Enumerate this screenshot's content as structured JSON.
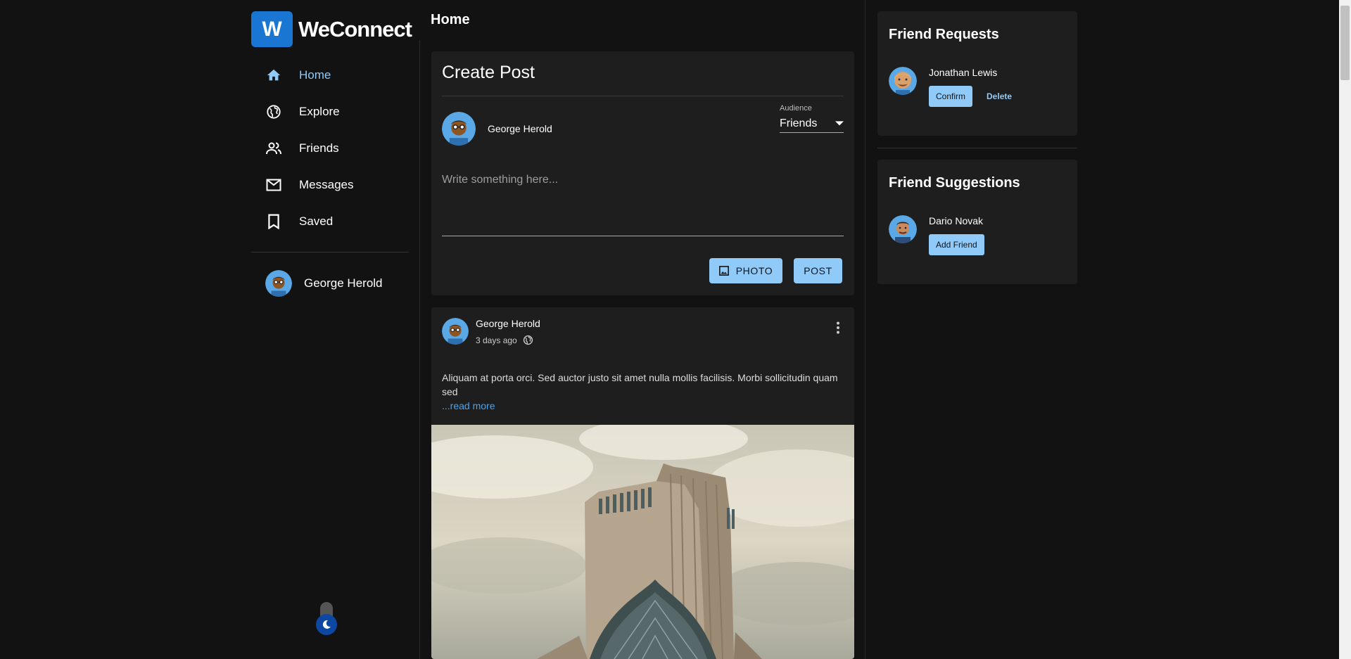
{
  "app": {
    "logo_letter": "W",
    "name": "WeConnect",
    "brand_color": "#1976d2",
    "accent_color": "#90caf9"
  },
  "nav": {
    "items": [
      {
        "label": "Home",
        "icon": "home-icon",
        "active": true
      },
      {
        "label": "Explore",
        "icon": "globe-icon",
        "active": false
      },
      {
        "label": "Friends",
        "icon": "people-icon",
        "active": false
      },
      {
        "label": "Messages",
        "icon": "mail-icon",
        "active": false
      },
      {
        "label": "Saved",
        "icon": "bookmark-icon",
        "active": false
      }
    ]
  },
  "current_user": {
    "name": "George Herold"
  },
  "theme_toggle": {
    "icon": "moon-icon",
    "mode": "dark"
  },
  "header": {
    "title": "Home"
  },
  "create_post": {
    "title": "Create Post",
    "author": "George Herold",
    "audience_label": "Audience",
    "audience_value": "Friends",
    "placeholder": "Write something here...",
    "photo_label": "PHOTO",
    "post_label": "POST"
  },
  "post": {
    "author": "George Herold",
    "time": "3 days ago",
    "visibility_icon": "globe-icon",
    "text": "Aliquam at porta orci. Sed auctor justo sit amet nulla mollis facilisis. Morbi sollicitudin quam sed",
    "read_more": "...read more"
  },
  "friend_requests": {
    "title": "Friend Requests",
    "items": [
      {
        "name": "Jonathan Lewis",
        "confirm_label": "Confirm",
        "delete_label": "Delete"
      }
    ]
  },
  "friend_suggestions": {
    "title": "Friend Suggestions",
    "items": [
      {
        "name": "Dario Novak",
        "add_label": "Add Friend"
      }
    ]
  }
}
